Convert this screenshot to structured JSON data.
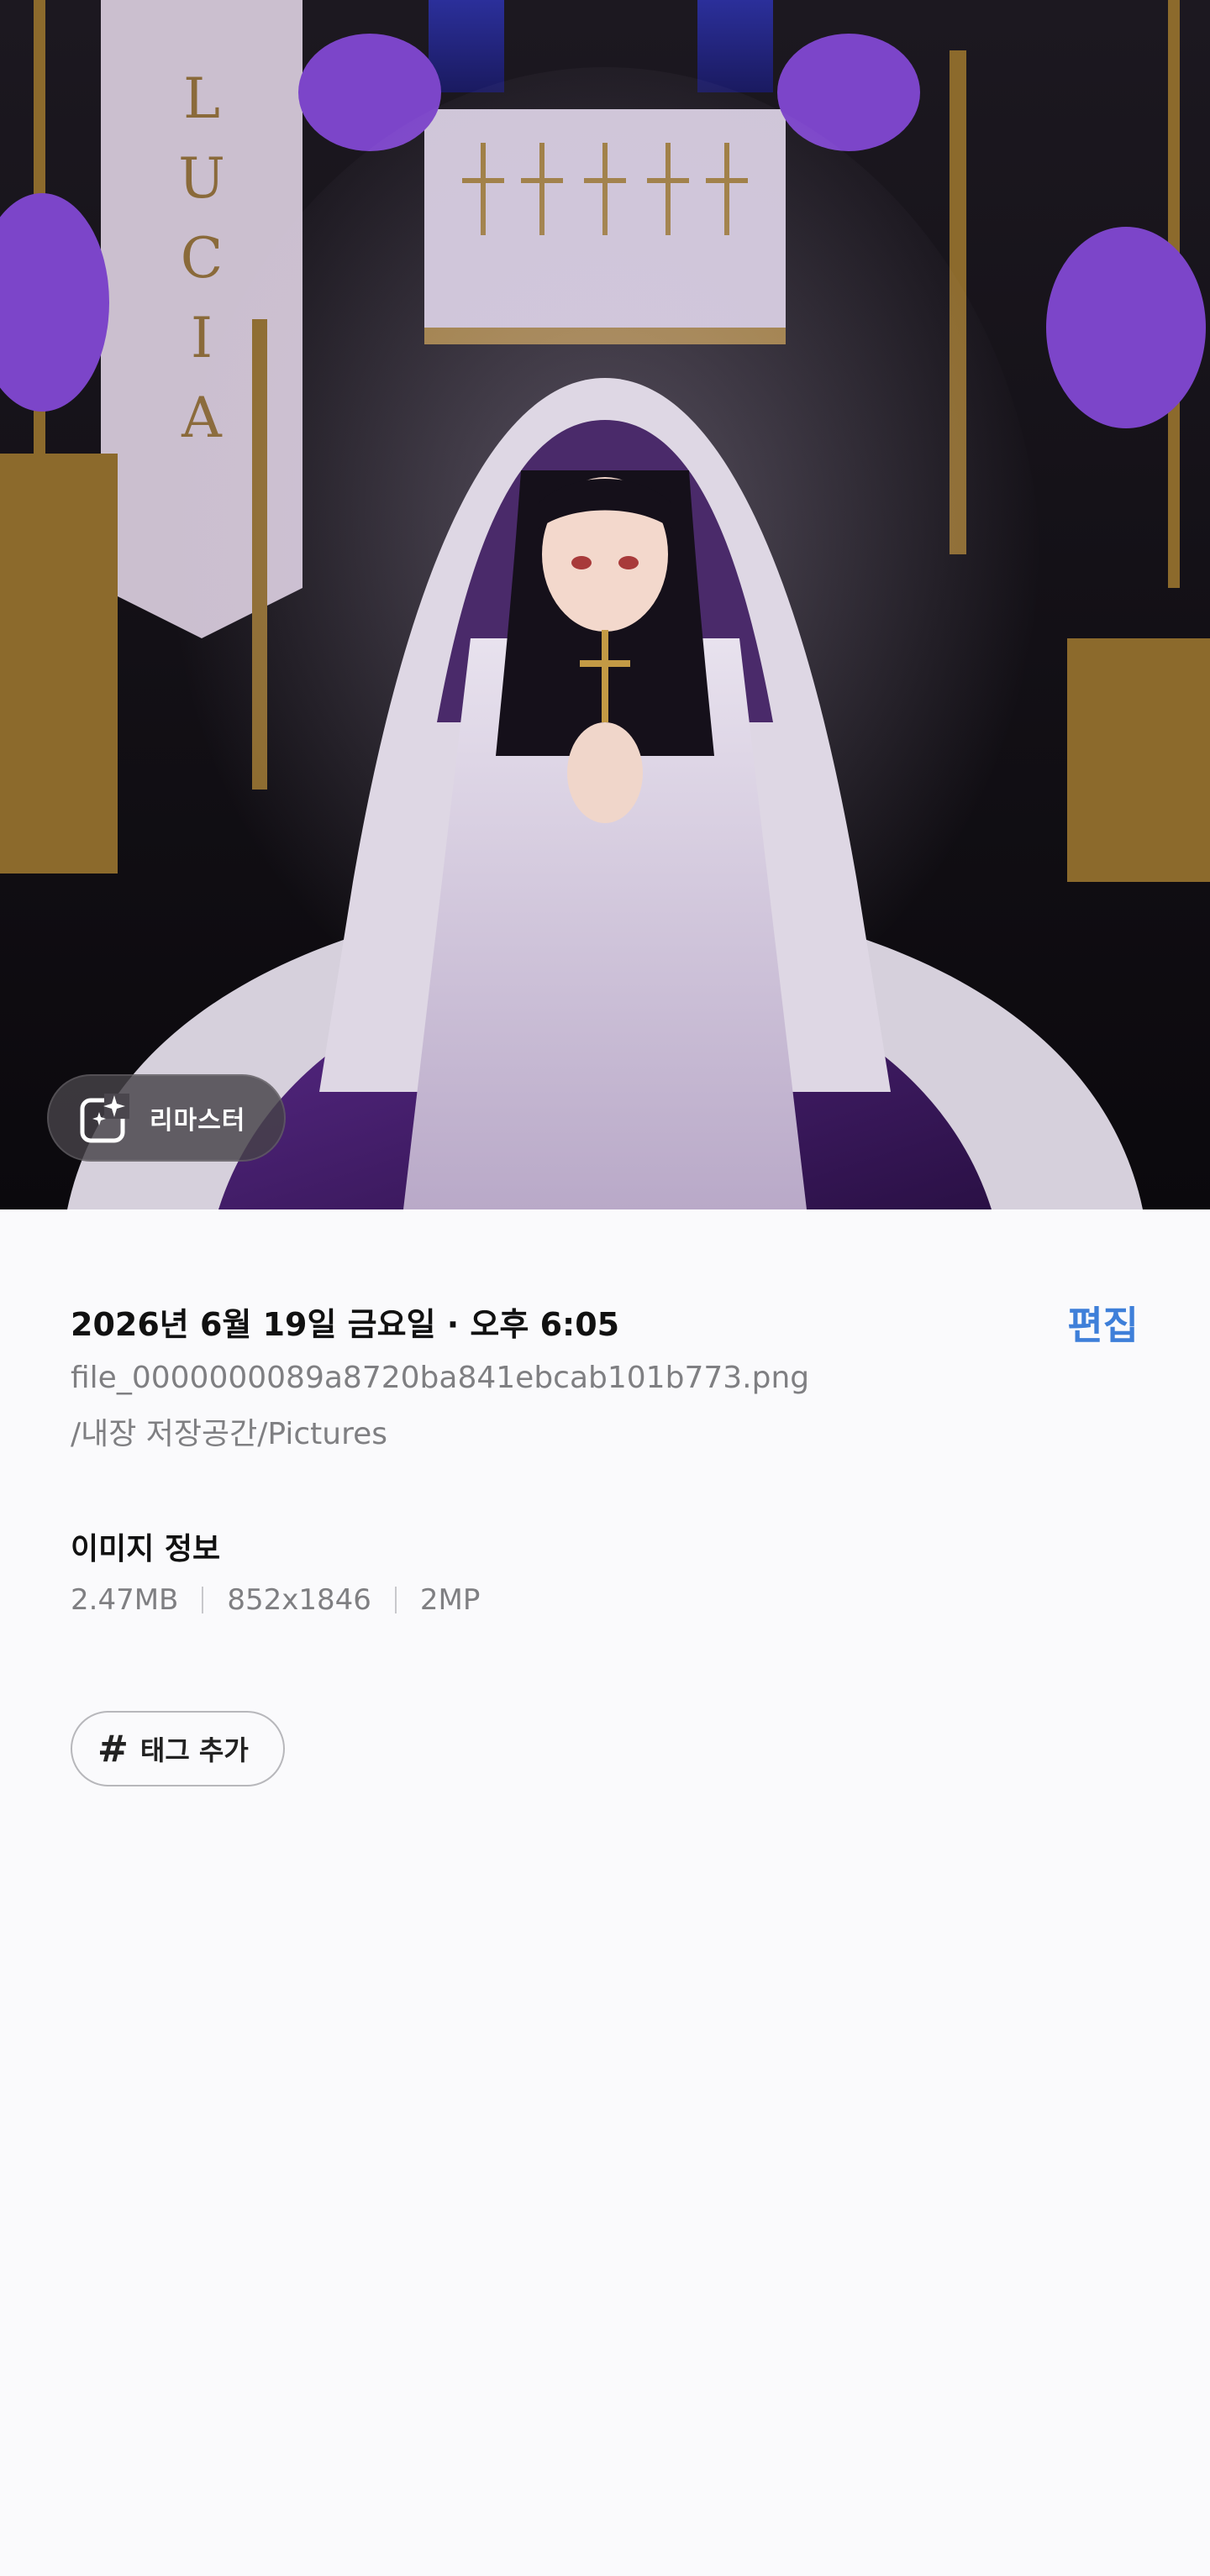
{
  "hero": {
    "image_name": "praying-nun-illustration",
    "banner_text": "LUCIA",
    "remaster_label": "리마스터"
  },
  "details": {
    "date": "2026년 6월 19일 금요일 · 오후 6:05",
    "edit_label": "편집",
    "filename": "file_0000000089a8720ba841ebcab101b773.png",
    "path": "/내장 저장공간/Pictures"
  },
  "image_info": {
    "title": "이미지 정보",
    "size": "2.47MB",
    "resolution": "852x1846",
    "megapixels": "2MP"
  },
  "tags": {
    "hash_symbol": "#",
    "add_label": "태그 추가"
  },
  "colors": {
    "accent": "#3e7fd9",
    "background": "#fafafc",
    "muted_text": "#7f7f82"
  }
}
